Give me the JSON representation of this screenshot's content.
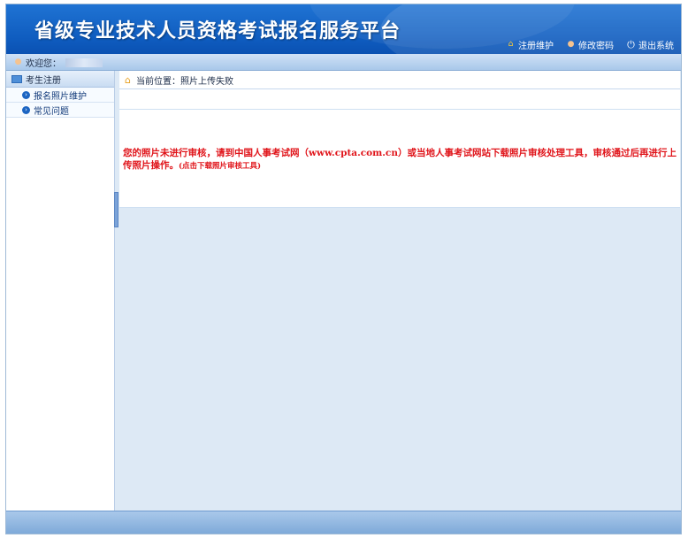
{
  "header": {
    "title": "省级专业技术人员资格考试报名服务平台",
    "links": [
      {
        "label": "注册维护",
        "icon": "home-icon"
      },
      {
        "label": "修改密码",
        "icon": "user-icon"
      },
      {
        "label": "退出系统",
        "icon": "power-icon"
      }
    ]
  },
  "userbar": {
    "welcome": "欢迎您："
  },
  "sidebar": {
    "section": "考生注册",
    "items": [
      {
        "label": "报名照片维护",
        "icon": "arrow-circle-icon"
      },
      {
        "label": "常见问题",
        "icon": "arrow-circle-icon"
      }
    ]
  },
  "breadcrumb": {
    "text": "当前位置：照片上传失败"
  },
  "message": {
    "text": "您的照片未进行审核，请到中国人事考试网（www.cpta.com.cn）或当地人事考试网站下载照片审核处理工具，审核通过后再进行上传照片操作。",
    "link": "(点击下载照片审核工具)"
  },
  "colors": {
    "header_blue": "#0f5cbf",
    "error_red": "#e0141a",
    "panel_bg": "#dde9f5"
  }
}
